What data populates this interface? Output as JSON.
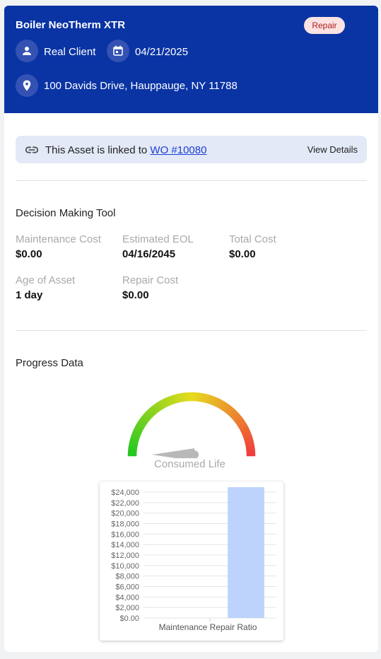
{
  "asset": {
    "name": "Boiler NeoTherm XTR",
    "status": "Repair",
    "client": "Real Client",
    "date": "04/21/2025",
    "address": "100 Davids Drive, Hauppauge, NY 11788"
  },
  "link": {
    "text": "This Asset is linked to",
    "wo": "WO #10080",
    "view_details": "View Details"
  },
  "decision": {
    "title": "Decision Making Tool",
    "metrics": [
      {
        "label": "Maintenance Cost",
        "value": "$0.00"
      },
      {
        "label": "Estimated EOL",
        "value": "04/16/2045"
      },
      {
        "label": "Total Cost",
        "value": "$0.00"
      },
      {
        "label": "Age of Asset",
        "value": "1 day"
      },
      {
        "label": "Repair Cost",
        "value": "$0.00"
      }
    ]
  },
  "progress": {
    "title": "Progress Data",
    "gauge_label": "Consumed Life",
    "gauge_value": 0
  },
  "colors": {
    "header_bg": "#0a34a4",
    "bar_fill": "#bdd3fb",
    "link": "#1a3fd1"
  },
  "chart_data": {
    "type": "bar",
    "xlabel": "Maintenance Repair Ratio",
    "ylim": [
      0,
      24000
    ],
    "y_ticks": [
      "$0.00",
      "$2,000",
      "$4,000",
      "$6,000",
      "$8,000",
      "$10,000",
      "$12,000",
      "$14,000",
      "$16,000",
      "$18,000",
      "$20,000",
      "$22,000",
      "$24,000"
    ],
    "categories": [
      "",
      ""
    ],
    "values": [
      0,
      25000
    ]
  }
}
